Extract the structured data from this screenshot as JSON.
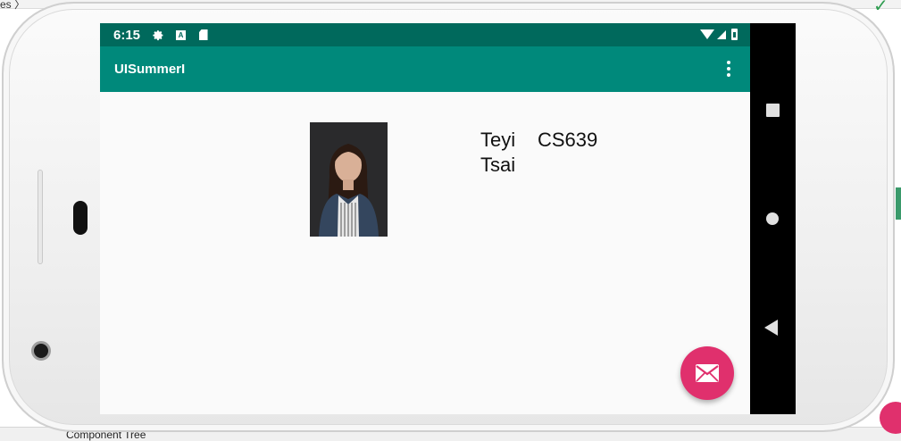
{
  "ide": {
    "crumb": "es 〉",
    "bottom_label": "Component Tree",
    "check_icon": "checkmark-icon"
  },
  "status_bar": {
    "time": "6:15",
    "icons": [
      "gear-icon",
      "a-box-icon",
      "sd-card-icon",
      "wifi-icon",
      "signal-icon",
      "battery-icon"
    ],
    "color": "#00695c"
  },
  "app_bar": {
    "title": "UISummerI",
    "menu_icon": "more-vert-icon",
    "color": "#00897b"
  },
  "profile": {
    "photo_alt": "profile-photo",
    "name": "Teyi Tsai",
    "course": "CS639"
  },
  "fab": {
    "icon": "mail-icon",
    "color": "#e0306d"
  },
  "nav_bar": {
    "icons": [
      "recent-apps-icon",
      "home-icon",
      "back-icon"
    ]
  }
}
